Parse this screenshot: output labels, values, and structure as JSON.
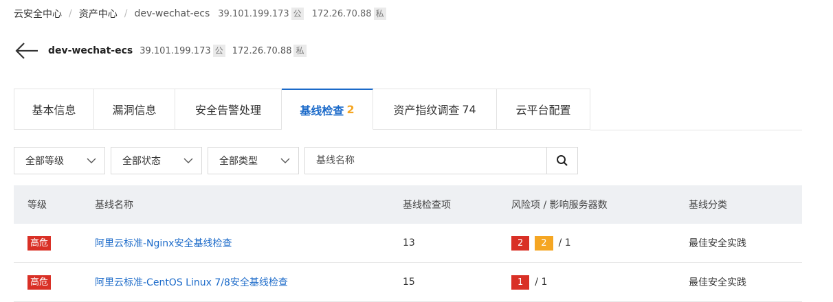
{
  "colors": {
    "accent": "#1b6ac9",
    "high": "#d93026",
    "medium": "#f5a623"
  },
  "breadcrumb": {
    "items": [
      "云安全中心",
      "资产中心",
      "dev-wechat-ecs"
    ],
    "separator": "/",
    "public_ip": "39.101.199.173",
    "public_tag": "公",
    "private_ip": "172.26.70.88",
    "private_tag": "私"
  },
  "header": {
    "name": "dev-wechat-ecs",
    "public_ip": "39.101.199.173",
    "public_tag": "公",
    "private_ip": "172.26.70.88",
    "private_tag": "私"
  },
  "tabs": [
    {
      "label": "基本信息",
      "count": ""
    },
    {
      "label": "漏洞信息",
      "count": ""
    },
    {
      "label": "安全告警处理",
      "count": ""
    },
    {
      "label": "基线检查",
      "count": "2"
    },
    {
      "label": "资产指纹调查",
      "count": "74"
    },
    {
      "label": "云平台配置",
      "count": ""
    }
  ],
  "filters": {
    "level": "全部等级",
    "status": "全部状态",
    "type": "全部类型",
    "search_placeholder": "基线名称"
  },
  "table": {
    "headers": [
      "等级",
      "基线名称",
      "基线检查项",
      "风险项 / 影响服务器数",
      "基线分类"
    ],
    "rows": [
      {
        "level": "高危",
        "name": "阿里云标准-Nginx安全基线检查",
        "items": "13",
        "risk_red": "2",
        "risk_orange": "2",
        "servers": "/ 1",
        "category": "最佳安全实践"
      },
      {
        "level": "高危",
        "name": "阿里云标准-CentOS Linux 7/8安全基线检查",
        "items": "15",
        "risk_red": "1",
        "servers": "/ 1",
        "category": "最佳安全实践"
      }
    ]
  }
}
